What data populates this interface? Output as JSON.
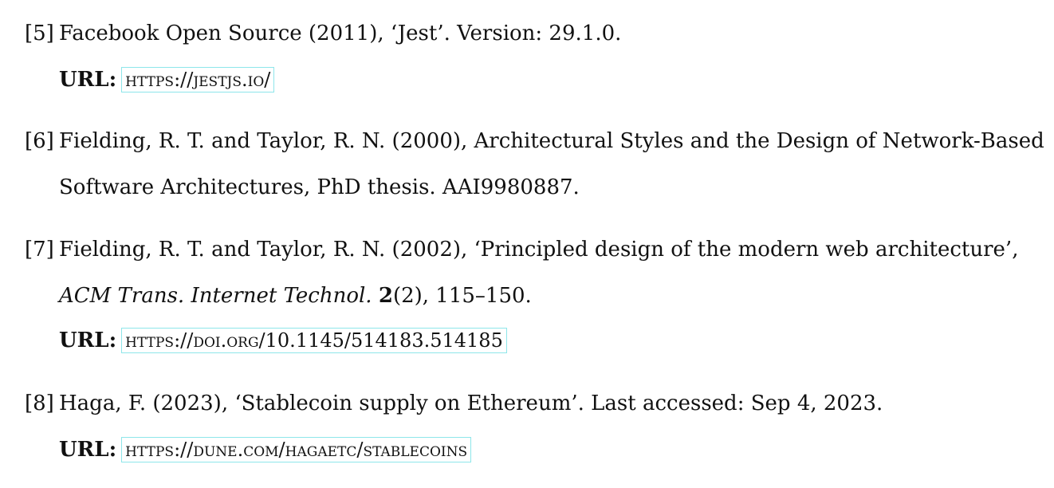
{
  "refs": [
    {
      "num": "[5]",
      "line1": "Facebook Open Source (2011), ‘Jest’. Version: 29.1.0.",
      "url_label": "URL:",
      "url": "https://jestjs.io/"
    },
    {
      "num": "[6]",
      "line1": "Fielding, R. T. and Taylor, R. N. (2000), Architectural Styles and the Design of Network-Based",
      "line2": "Software Architectures, PhD thesis. AAI9980887."
    },
    {
      "num": "[7]",
      "line1": "Fielding, R. T. and Taylor, R. N. (2002), ‘Principled design of the modern web architecture’,",
      "journal": "ACM Trans. Internet Technol.",
      "volume": "2",
      "rest": "(2), 115–150.",
      "url_label": "URL:",
      "url": "https://doi.org/10.1145/514183.514185"
    },
    {
      "num": "[8]",
      "line1": "Haga, F. (2023), ‘Stablecoin supply on Ethereum’. Last accessed: Sep 4, 2023.",
      "url_label": "URL:",
      "url": "https://dune.com/hagaetc/stablecoins"
    }
  ]
}
